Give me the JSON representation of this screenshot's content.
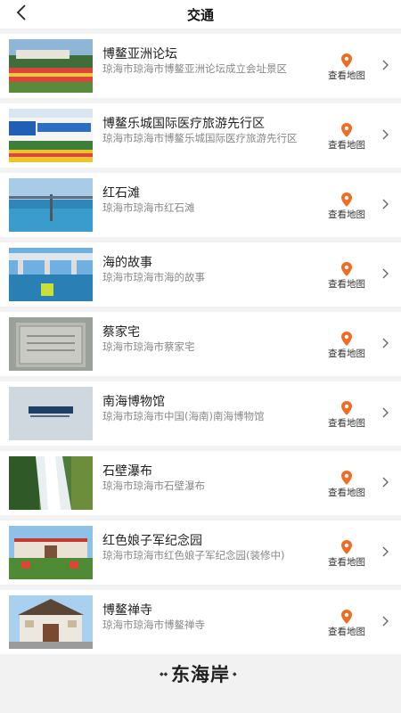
{
  "header": {
    "back_icon": "chevron-left-icon",
    "title": "交通"
  },
  "places": [
    {
      "name": "博鳌亚洲论坛",
      "address": "琼海市琼海市博鳌亚洲论坛成立会址景区",
      "map_label": "查看地图"
    },
    {
      "name": "博鳌乐城国际医疗旅游先行区",
      "address": "琼海市琼海市博鳌乐城国际医疗旅游先行区",
      "map_label": "查看地图"
    },
    {
      "name": "红石滩",
      "address": "琼海市琼海市红石滩",
      "map_label": "查看地图"
    },
    {
      "name": "海的故事",
      "address": "琼海市琼海市海的故事",
      "map_label": "查看地图"
    },
    {
      "name": "蔡家宅",
      "address": "琼海市琼海市蔡家宅",
      "map_label": "查看地图"
    },
    {
      "name": "南海博物馆",
      "address": "琼海市琼海市中国(海南)南海博物馆",
      "map_label": "查看地图"
    },
    {
      "name": "石壁瀑布",
      "address": "琼海市琼海市石壁瀑布",
      "map_label": "查看地图"
    },
    {
      "name": "红色娘子军纪念园",
      "address": "琼海市琼海市红色娘子军纪念园(装修中)",
      "map_label": "查看地图"
    },
    {
      "name": "博鳌禅寺",
      "address": "琼海市琼海市博鳌禅寺",
      "map_label": "查看地图"
    }
  ],
  "footer": {
    "logo_text": "东海岸"
  },
  "colors": {
    "pin": "#f26b21",
    "chevron": "#666666",
    "background": "#f2f2f2"
  }
}
